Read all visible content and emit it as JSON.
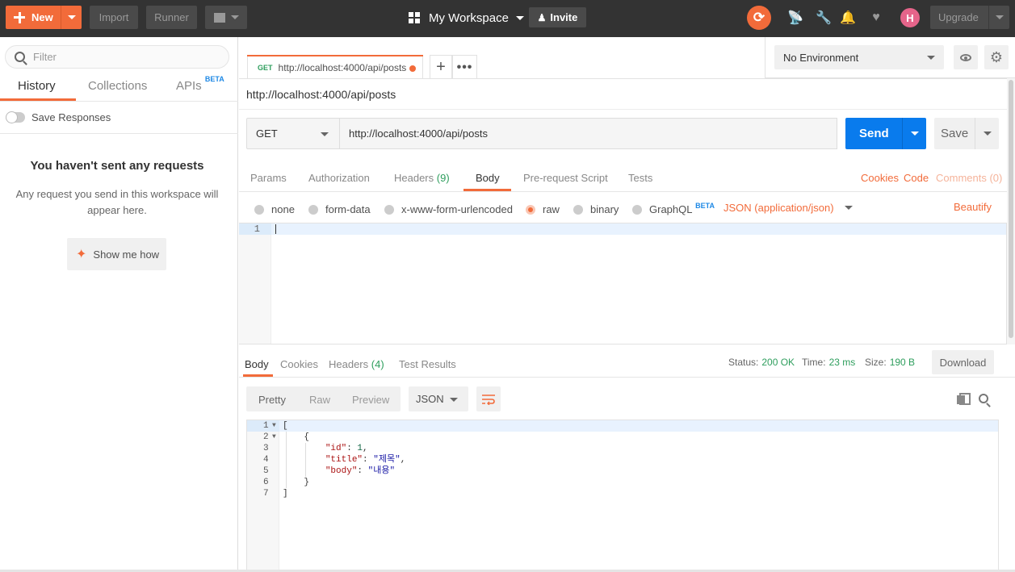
{
  "topbar": {
    "new_label": "New",
    "import_label": "Import",
    "runner_label": "Runner",
    "workspace_label": "My Workspace",
    "invite_label": "Invite",
    "avatar_letter": "H",
    "upgrade_label": "Upgrade"
  },
  "sidebar": {
    "filter_placeholder": "Filter",
    "tabs": {
      "history": "History",
      "collections": "Collections",
      "apis": "APIs",
      "apis_badge": "BETA"
    },
    "save_responses": "Save Responses",
    "empty_title": "You haven't sent any requests",
    "empty_desc": "Any request you send in this workspace will appear here.",
    "show_me_how": "Show me how"
  },
  "request_tab": {
    "method": "GET",
    "url": "http://localhost:4000/api/posts"
  },
  "environment": {
    "selected": "No Environment"
  },
  "request": {
    "name": "http://localhost:4000/api/posts",
    "method": "GET",
    "url": "http://localhost:4000/api/posts",
    "send_label": "Send",
    "save_label": "Save",
    "tabs": {
      "params": "Params",
      "authorization": "Authorization",
      "headers": "Headers",
      "headers_count": "(9)",
      "body": "Body",
      "prerequest": "Pre-request Script",
      "tests": "Tests"
    },
    "links": {
      "cookies": "Cookies",
      "code": "Code",
      "comments": "Comments (0)"
    },
    "body_types": {
      "none": "none",
      "form_data": "form-data",
      "urlencoded": "x-www-form-urlencoded",
      "raw": "raw",
      "binary": "binary",
      "graphql": "GraphQL",
      "graphql_badge": "BETA"
    },
    "content_type": "JSON (application/json)",
    "beautify": "Beautify",
    "editor_line": "1"
  },
  "response": {
    "tabs": {
      "body": "Body",
      "cookies": "Cookies",
      "headers": "Headers",
      "headers_count": "(4)",
      "test_results": "Test Results"
    },
    "status_label": "Status:",
    "status_value": "200 OK",
    "time_label": "Time:",
    "time_value": "23 ms",
    "size_label": "Size:",
    "size_value": "190 B",
    "download_label": "Download",
    "formats": {
      "pretty": "Pretty",
      "raw": "Raw",
      "preview": "Preview"
    },
    "language": "JSON",
    "line_numbers": [
      "1",
      "2",
      "3",
      "4",
      "5",
      "6",
      "7"
    ],
    "body": {
      "open_bracket": "[",
      "open_brace": "{",
      "id_key": "\"id\"",
      "id_value": "1",
      "title_key": "\"title\"",
      "title_value": "\"제목\"",
      "body_key": "\"body\"",
      "body_value": "\"내용\"",
      "close_brace": "}",
      "close_bracket": "]"
    }
  }
}
